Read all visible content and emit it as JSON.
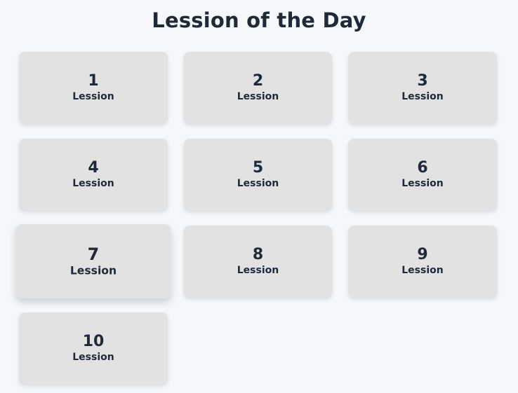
{
  "header": {
    "title": "Lession of the Day"
  },
  "lessons": [
    {
      "number": "1",
      "label": "Lession"
    },
    {
      "number": "2",
      "label": "Lession"
    },
    {
      "number": "3",
      "label": "Lession"
    },
    {
      "number": "4",
      "label": "Lession"
    },
    {
      "number": "5",
      "label": "Lession"
    },
    {
      "number": "6",
      "label": "Lession"
    },
    {
      "number": "7",
      "label": "Lession"
    },
    {
      "number": "8",
      "label": "Lession"
    },
    {
      "number": "9",
      "label": "Lession"
    },
    {
      "number": "10",
      "label": "Lession"
    }
  ],
  "colors": {
    "background": "#f4f8fb",
    "card": "#e2e2e2",
    "text": "#1f2937"
  }
}
